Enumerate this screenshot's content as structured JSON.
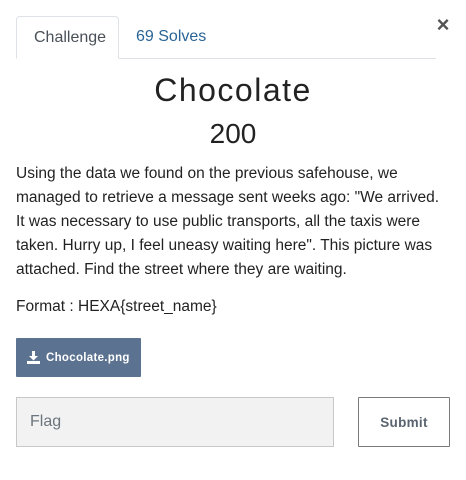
{
  "modal": {
    "close_label": "×",
    "tabs": [
      {
        "label": "Challenge",
        "active": true
      },
      {
        "label": "69 Solves",
        "active": false
      }
    ]
  },
  "challenge": {
    "name": "Chocolate",
    "value": "200",
    "description": [
      "Using the data we found on the previous safehouse, we managed to retrieve a message sent weeks ago: \"We arrived. It was necessary to use public transports, all the taxis were taken. Hurry up, I feel uneasy waiting here\". This picture was attached. Find the street where they are waiting.",
      "Format : HEXA{street_name}"
    ],
    "file": {
      "label": "Chocolate.png",
      "icon": "download-icon"
    }
  },
  "form": {
    "flag_placeholder": "Flag",
    "flag_value": "",
    "submit_label": "Submit"
  },
  "colors": {
    "file_button": "#5b7290",
    "link": "#2a6496",
    "input_bg": "#f2f2f2"
  }
}
